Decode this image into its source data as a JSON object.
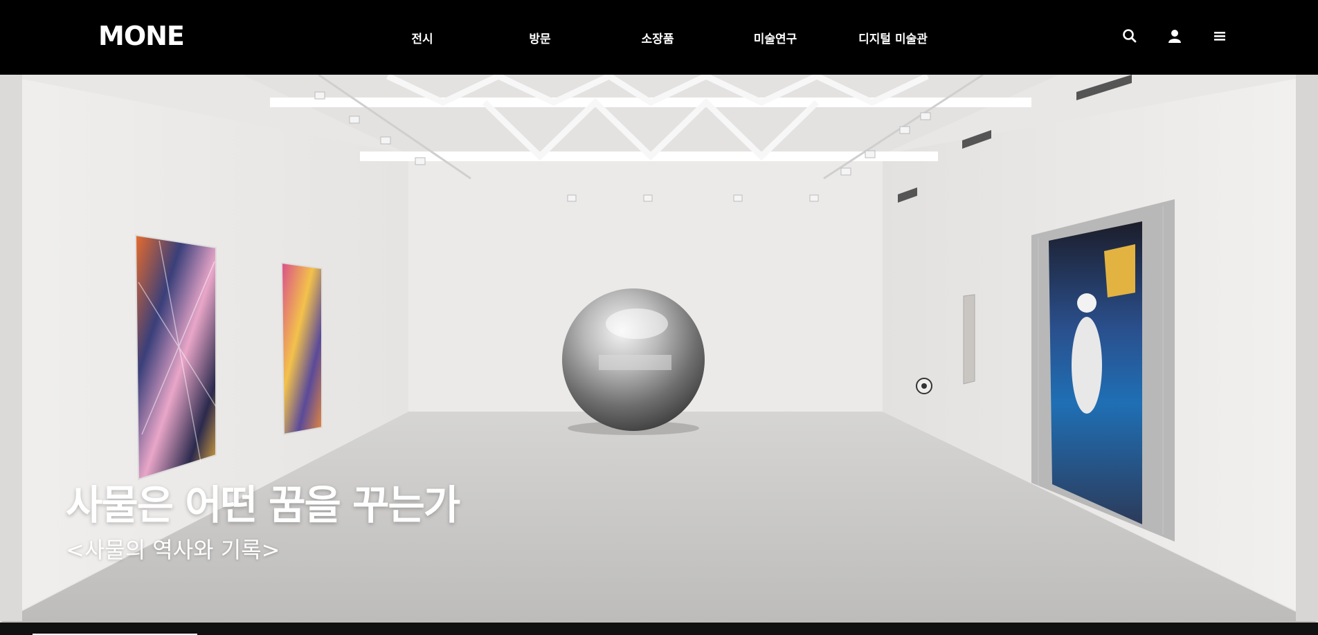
{
  "brand": {
    "logo": "MONE"
  },
  "nav": {
    "items": [
      {
        "label": "전시"
      },
      {
        "label": "방문"
      },
      {
        "label": "소장품"
      },
      {
        "label": "미술연구"
      },
      {
        "label": "디지털 미술관"
      }
    ]
  },
  "header_icons": [
    "search-icon",
    "user-icon",
    "menu-icon"
  ],
  "hero": {
    "title": "사물은 어떤 꿈을 꾸는가",
    "subtitle": "<사물의 역사와 기록>"
  },
  "slider": {
    "progress": 0.125
  },
  "colors": {
    "header_bg": "#000000",
    "text": "#ffffff",
    "wall": "#ebe9e7",
    "floor": "#c9c8c6"
  }
}
